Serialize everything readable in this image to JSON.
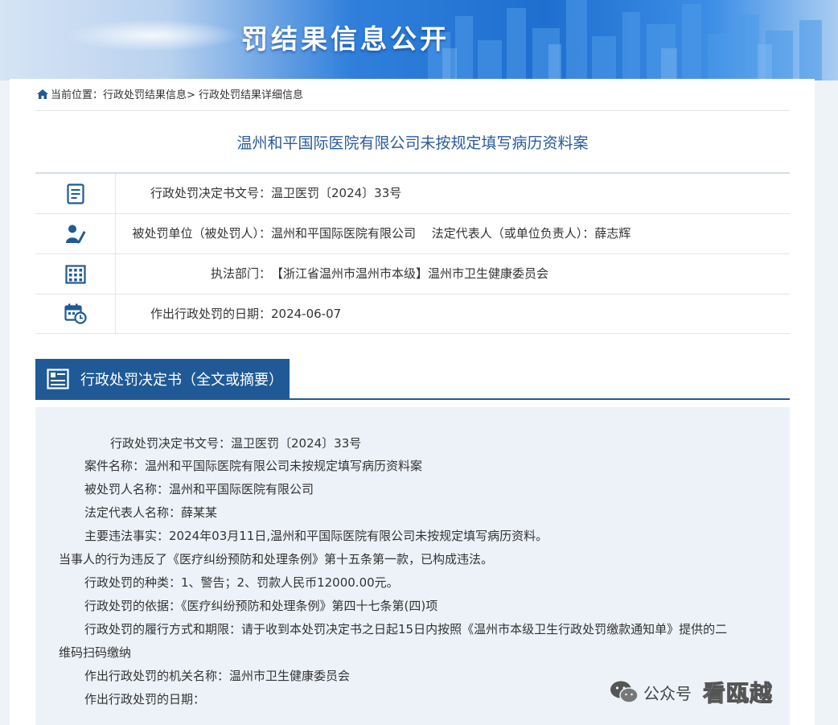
{
  "banner": {
    "title": "罚结果信息公开"
  },
  "breadcrumb": {
    "prefix": "当前位置：",
    "items": [
      "行政处罚结果信息",
      "行政处罚结果详细信息"
    ],
    "sep": ">"
  },
  "case_title": "温州和平国际医院有限公司未按规定填写病历资料案",
  "info_rows": [
    {
      "icon": "document-icon",
      "label": "行政处罚决定书文号：",
      "value": "温卫医罚〔2024〕33号"
    },
    {
      "icon": "person-icon",
      "label": "被处罚单位（被处罚人）：",
      "value": "温州和平国际医院有限公司　 法定代表人（或单位负责人）：薛志辉"
    },
    {
      "icon": "building-icon",
      "label": "执法部门：",
      "value": "【浙江省温州市温州市本级】温州市卫生健康委员会"
    },
    {
      "icon": "calendar-clock-icon",
      "label": "作出行政处罚的日期：",
      "value": "2024-06-07"
    }
  ],
  "section": {
    "title": "行政处罚决定书（全文或摘要）",
    "icon": "document-list-icon"
  },
  "document_lines": [
    "行政处罚决定书文号：温卫医罚〔2024〕33号",
    "案件名称：温州和平国际医院有限公司未按规定填写病历资料案",
    "被处罚人名称：温州和平国际医院有限公司",
    "法定代表人名称：薛某某",
    "主要违法事实：2024年03月11日,温州和平国际医院有限公司未按规定填写病历资料。",
    "当事人的行为违反了《医疗纠纷预防和处理条例》第十五条第一款，已构成违法。",
    "行政处罚的种类：1、警告；2、罚款人民币12000.00元。",
    "行政处罚的依据：《医疗纠纷预防和处理条例》第四十七条第(四)项",
    "行政处罚的履行方式和期限：请于收到本处罚决定书之日起15日内按照《温州市本级卫生行政处罚缴款通知单》提供的二",
    "维码扫码缴纳",
    "作出行政处罚的机关名称：温州市卫生健康委员会",
    "作出行政处罚的日期："
  ],
  "watermark": {
    "platform": "公众号",
    "account": "看瓯越"
  },
  "colors": {
    "primary": "#1f5a96",
    "title_blue": "#2b5c9a",
    "doc_bg": "#edf2f8"
  }
}
